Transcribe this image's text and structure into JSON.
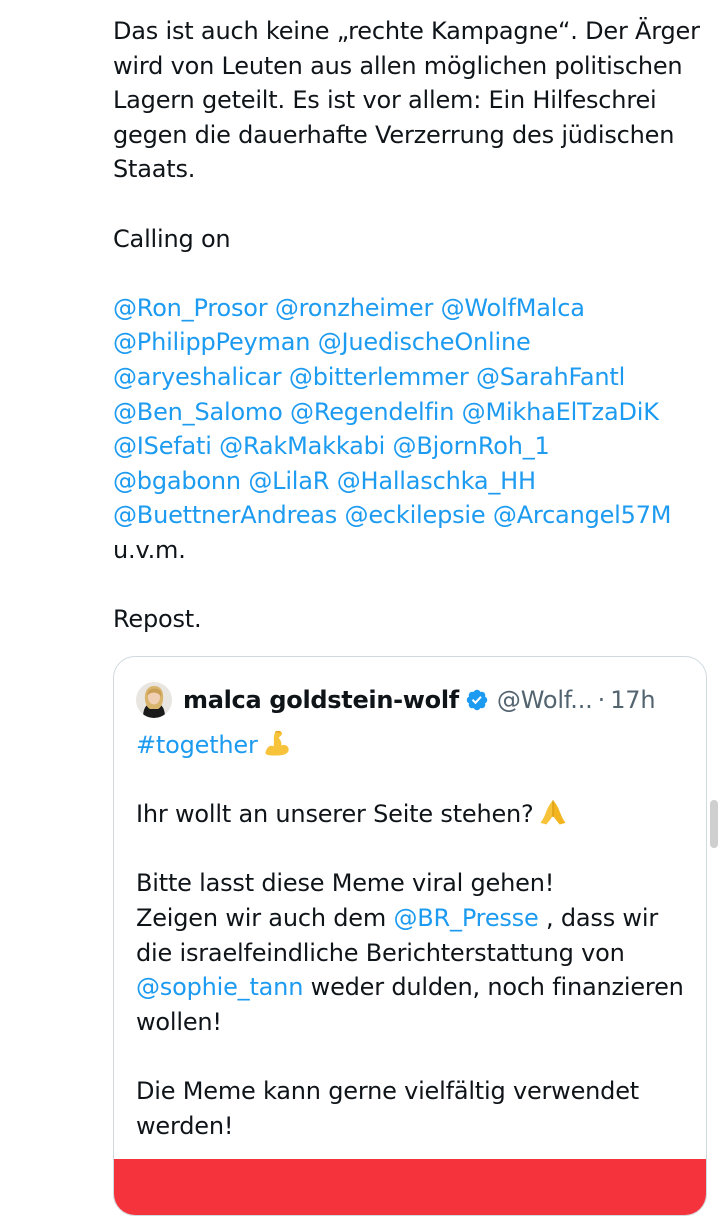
{
  "post": {
    "paragraph1": "Das ist auch keine „rechte Kampagne“. Der Ärger wird von Leuten aus allen möglichen politischen Lagern geteilt. Es ist vor allem: Ein Hilfeschrei gegen die dauerhafte Verzerrung des jüdischen Staats.",
    "calling_on": "Calling on",
    "mentions": [
      [
        "@Ron_Prosor",
        "@ronzheimer",
        "@WolfMalca"
      ],
      [
        "@PhilippPeyman",
        "@JuedischeOnline"
      ],
      [
        "@aryeshalicar",
        "@bitterlemmer",
        "@SarahFantl"
      ],
      [
        "@Ben_Salomo",
        "@Regendelfin",
        "@MikhaElTzaDiK"
      ],
      [
        "@ISefati",
        "@RakMakkabi",
        "@BjornRoh_1"
      ],
      [
        "@bgabonn",
        "@LilaR",
        "@Hallaschka_HH"
      ],
      [
        "@BuettnerAndreas",
        "@eckilepsie",
        "@Arcangel57M"
      ]
    ],
    "uvm": "u.v.m.",
    "repost": "Repost."
  },
  "quote": {
    "author_name": "malca goldstein-wolf",
    "handle": "@Wolf...",
    "separator": "·",
    "time": "17h",
    "hashtag": "#together",
    "line1": "Ihr wollt an unserer Seite stehen?",
    "line2": "Bitte lasst diese Meme viral gehen!",
    "line3_before": "Zeigen wir auch dem ",
    "line3_mention": "@BR_Presse",
    "line3_after": " , dass wir die israelfeindliche Berichterstattung von ",
    "line3_mention2": "@sophie_tann",
    "line3_end": " weder dulden, noch finanzieren wollen!",
    "line4": "Die Meme kann gerne vielfältig verwendet werden!",
    "emoji_hashtag": "flexed-biceps",
    "emoji_line1": "folded-hands"
  },
  "colors": {
    "link": "#1d9bf0",
    "secondary_text": "#536471",
    "verified": "#1d9bf0",
    "media_strip": "#f4333c",
    "border": "#cfd9de"
  }
}
